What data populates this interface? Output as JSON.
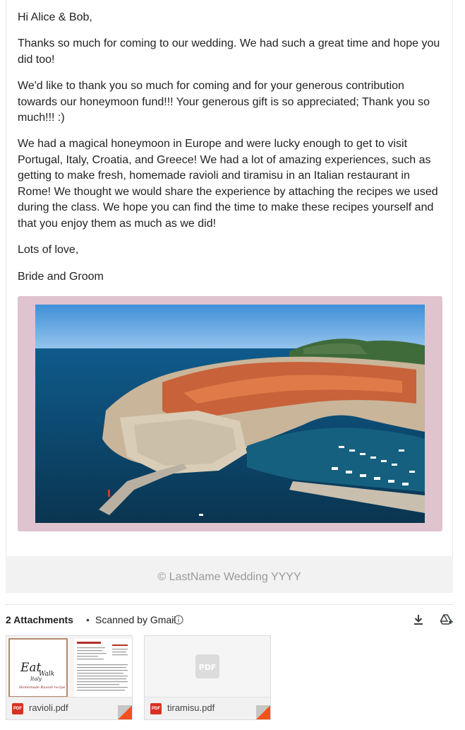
{
  "email": {
    "greeting": "Hi Alice & Bob,",
    "paragraphs": [
      "Thanks so much for coming to our wedding. We had such a great time and hope you did too!",
      "We'd like to thank you so much for coming and for your generous contribution towards our honeymoon fund!!! Your generous gift is so appreciated; Thank you so much!!! :)",
      "We had a magical honeymoon in Europe and were lucky enough to get to visit Portugal, Italy, Croatia, and Greece! We had a lot of amazing experiences, such as getting to make fresh, homemade ravioli and tiramisu in an Italian restaurant in Rome! We thought we would share the experience by attaching the recipes we used during the class. We hope you can find the time to make these recipes yourself and that you enjoy them as much as we did!"
    ],
    "closing": "Lots of love,",
    "signature": "Bride and Groom",
    "photo_frame_color": "#dfc3cf"
  },
  "footer": {
    "text": "© LastName Wedding YYYY"
  },
  "attachments": {
    "count_label": "2 Attachments",
    "separator": "•",
    "scanned_label": "Scanned by Gmail",
    "files": [
      {
        "name": "ravioli.pdf",
        "icon": "pdf-icon"
      },
      {
        "name": "tiramisu.pdf",
        "icon": "pdf-icon"
      }
    ],
    "preview": {
      "ravioli_logo": [
        "Eat",
        "Walk",
        "Italy"
      ],
      "ravioli_caption": "Homemade Ravioli recipe",
      "generic_label": "PDF"
    }
  }
}
